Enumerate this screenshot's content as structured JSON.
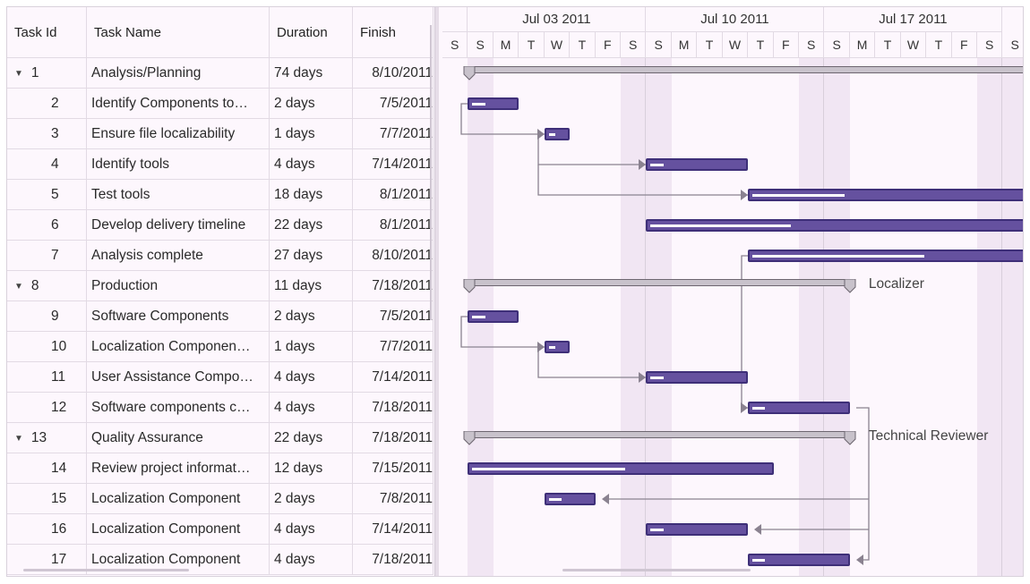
{
  "grid": {
    "columns": [
      "Task Id",
      "Task Name",
      "Duration",
      "Finish"
    ]
  },
  "timeline": {
    "weeks": [
      "Jul 03 2011",
      "Jul 10 2011",
      "Jul 17 2011"
    ],
    "days": [
      "S",
      "S",
      "M",
      "T",
      "W",
      "T",
      "F",
      "S",
      "S",
      "M",
      "T",
      "W",
      "T",
      "F",
      "S",
      "S",
      "M",
      "T",
      "W",
      "T",
      "F",
      "S",
      "S"
    ],
    "first_day": "2011-07-02"
  },
  "colors": {
    "bar": "#65519f",
    "bar_border": "#3e2f78",
    "parent": "#c8c2cb",
    "weekend": "#f1e6f3",
    "background": "#fdf7fd"
  },
  "tasks": [
    {
      "id": "1",
      "name": "Analysis/Planning",
      "duration": "74 days",
      "finish": "8/10/2011",
      "parent": true,
      "start": "2011-07-03",
      "days": 74
    },
    {
      "id": "2",
      "name": "Identify Components to…",
      "duration": "2 days",
      "finish": "7/5/2011",
      "start": "2011-07-03",
      "days": 2,
      "progress": 0.1
    },
    {
      "id": "3",
      "name": "Ensure file localizability",
      "duration": "1 days",
      "finish": "7/7/2011",
      "start": "2011-07-06",
      "days": 1,
      "progress": 0.1
    },
    {
      "id": "4",
      "name": "Identify tools",
      "duration": "4 days",
      "finish": "7/14/2011",
      "start": "2011-07-10",
      "days": 4,
      "progress": 0.05
    },
    {
      "id": "5",
      "name": "Test tools",
      "duration": "18 days",
      "finish": "8/1/2011",
      "start": "2011-07-14",
      "days": 18,
      "progress": 0.08
    },
    {
      "id": "6",
      "name": "Develop delivery timeline",
      "duration": "22 days",
      "finish": "8/1/2011",
      "start": "2011-07-10",
      "days": 22,
      "progress": 0.1
    },
    {
      "id": "7",
      "name": "Analysis complete",
      "duration": "27 days",
      "finish": "8/10/2011",
      "start": "2011-07-14",
      "days": 27,
      "progress": 0.1
    },
    {
      "id": "8",
      "name": "Production",
      "duration": "11 days",
      "finish": "7/18/2011",
      "parent": true,
      "start": "2011-07-03",
      "days": 15,
      "resource": "Localizer"
    },
    {
      "id": "9",
      "name": "Software Components",
      "duration": "2 days",
      "finish": "7/5/2011",
      "start": "2011-07-03",
      "days": 2,
      "progress": 0.1
    },
    {
      "id": "10",
      "name": "Localization Componen…",
      "duration": "1 days",
      "finish": "7/7/2011",
      "start": "2011-07-06",
      "days": 1,
      "progress": 0.1
    },
    {
      "id": "11",
      "name": "User Assistance Compo…",
      "duration": "4 days",
      "finish": "7/14/2011",
      "start": "2011-07-10",
      "days": 4,
      "progress": 0.05
    },
    {
      "id": "12",
      "name": "Software components c…",
      "duration": "4 days",
      "finish": "7/18/2011",
      "start": "2011-07-14",
      "days": 4,
      "progress": 0.05
    },
    {
      "id": "13",
      "name": "Quality Assurance",
      "duration": "22 days",
      "finish": "7/18/2011",
      "parent": true,
      "start": "2011-07-03",
      "days": 15,
      "resource": "Technical Reviewer"
    },
    {
      "id": "14",
      "name": "Review project informat…",
      "duration": "12 days",
      "finish": "7/15/2011",
      "start": "2011-07-03",
      "days": 12,
      "progress": 0.2
    },
    {
      "id": "15",
      "name": "Localization Component",
      "duration": "2 days",
      "finish": "7/8/2011",
      "start": "2011-07-06",
      "days": 2,
      "progress": 0.1
    },
    {
      "id": "16",
      "name": "Localization Component",
      "duration": "4 days",
      "finish": "7/14/2011",
      "start": "2011-07-10",
      "days": 4,
      "progress": 0.05
    },
    {
      "id": "17",
      "name": "Localization Component",
      "duration": "4 days",
      "finish": "7/18/2011",
      "start": "2011-07-14",
      "days": 4,
      "progress": 0.05
    }
  ]
}
